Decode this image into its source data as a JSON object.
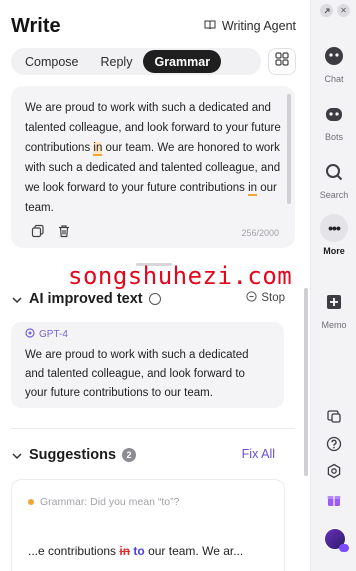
{
  "header": {
    "title": "Write",
    "agent_label": "Writing Agent"
  },
  "tabs": [
    {
      "label": "Compose",
      "active": false
    },
    {
      "label": "Reply",
      "active": false
    },
    {
      "label": "Grammar",
      "active": true
    }
  ],
  "editor": {
    "text_before": "We are proud to work with such a dedicated and talented colleague, and look forward to your future contributions ",
    "highlight_1": "in",
    "text_middle": " our team. We are honored to work with such a dedicated and talented colleague, and we look forward to your future contributions ",
    "highlight_2": "in",
    "text_after": " our team.",
    "counter": "256/2000"
  },
  "watermark": "songshuhezi.com",
  "ai": {
    "title": "AI improved text",
    "stop_label": "Stop",
    "model": "GPT-4",
    "text": "We are proud to work with such a dedicated and talented colleague, and look forward to your future contributions to our team."
  },
  "suggestions": {
    "title": "Suggestions",
    "count": "2",
    "fix_all": "Fix All",
    "item": {
      "title": "Grammar: Did you mean “to”?",
      "prefix": "...e contributions ",
      "deleted": "in",
      "inserted": "to",
      "suffix": " our team. We ar..."
    }
  },
  "rail": {
    "items": [
      {
        "label": "Chat",
        "icon": "chat-icon"
      },
      {
        "label": "Bots",
        "icon": "bots-icon"
      },
      {
        "label": "Search",
        "icon": "search-icon"
      },
      {
        "label": "More",
        "icon": "more-icon",
        "active": true
      },
      {
        "label": "Memo",
        "icon": "memo-icon"
      }
    ]
  },
  "colors": {
    "accent": "#6a4fd0",
    "highlight": "#f3a53b",
    "deleted": "#e03131",
    "watermark": "#e4061c"
  }
}
